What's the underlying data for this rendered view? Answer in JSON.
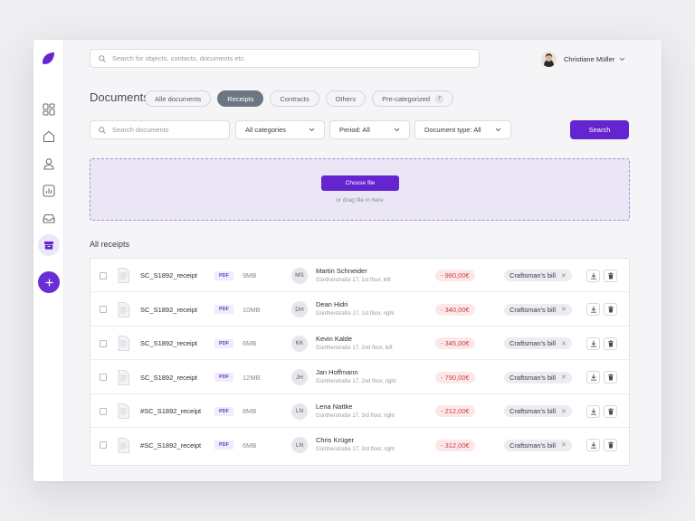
{
  "colors": {
    "accent": "#6424d0",
    "active_tab": "#6c7682",
    "amount_text": "#d23a47",
    "amount_bg": "#fbe9ea",
    "dropzone_bg": "#ebe6f6"
  },
  "sidebar": {
    "logo": "leaf-logo-icon",
    "items": [
      {
        "name": "dashboard",
        "icon": "grid-icon"
      },
      {
        "name": "home",
        "icon": "home-icon"
      },
      {
        "name": "contacts",
        "icon": "user-icon"
      },
      {
        "name": "reports",
        "icon": "bar-chart-icon"
      },
      {
        "name": "inbox",
        "icon": "inbox-icon"
      },
      {
        "name": "archive",
        "icon": "archive-icon",
        "active": true
      }
    ],
    "add_button_icon": "plus-icon"
  },
  "header": {
    "search_placeholder": "Search for objects, contacts, documents etc.",
    "user_name": "Christiane Müller"
  },
  "page": {
    "title": "Documents",
    "tabs": [
      {
        "label": "Alle documents",
        "active": false
      },
      {
        "label": "Receipts",
        "active": true
      },
      {
        "label": "Contracts",
        "active": false
      },
      {
        "label": "Others",
        "active": false
      },
      {
        "label": "Pre-categorized",
        "active": false,
        "count": "7"
      }
    ]
  },
  "filters": {
    "search_placeholder": "Search documents",
    "category": "All categories",
    "period": "Period: All",
    "doc_type": "Document type: All",
    "search_button": "Search"
  },
  "upload": {
    "button": "Choose file",
    "hint": "or drag file in here"
  },
  "receipts": {
    "title": "All receipts",
    "rows": [
      {
        "file": "SC_S1892_receipt",
        "type": "PDF",
        "size": "9MB",
        "initials": "MS",
        "name": "Martin Schneider",
        "address": "Güntherstraße 17, 1st floor, left",
        "amount": "- 980,00€",
        "tag": "Craftsman's bill"
      },
      {
        "file": "SC_S1892_receipt",
        "type": "PDF",
        "size": "10MB",
        "initials": "DH",
        "name": "Dean Hidri",
        "address": "Güntherstraße 17, 1st floor, right",
        "amount": "- 340,00€",
        "tag": "Craftsman's bill"
      },
      {
        "file": "SC_S1892_receipt",
        "type": "PDF",
        "size": "6MB",
        "initials": "KK",
        "name": "Kevin Kalde",
        "address": "Güntherstraße 17, 2nd floor, left",
        "amount": "- 345,00€",
        "tag": "Craftsman's bill"
      },
      {
        "file": "SC_S1892_receipt",
        "type": "PDF",
        "size": "12MB",
        "initials": "JH",
        "name": "Jan Hoffmann",
        "address": "Güntherstraße 17, 2nd floor, right",
        "amount": "- 790,00€",
        "tag": "Craftsman's bill"
      },
      {
        "file": "#SC_S1892_receipt",
        "type": "PDF",
        "size": "8MB",
        "initials": "LN",
        "name": "Lena Nattke",
        "address": "Güntherstraße 17, 3rd floor, right",
        "amount": "- 212,00€",
        "tag": "Craftsman's bill"
      },
      {
        "file": "#SC_S1892_receipt",
        "type": "PDF",
        "size": "6MB",
        "initials": "LN",
        "name": "Chris Krüger",
        "address": "Güntherstraße 17, 3rd floor, right",
        "amount": "- 312,00€",
        "tag": "Craftsman's bill"
      }
    ]
  }
}
